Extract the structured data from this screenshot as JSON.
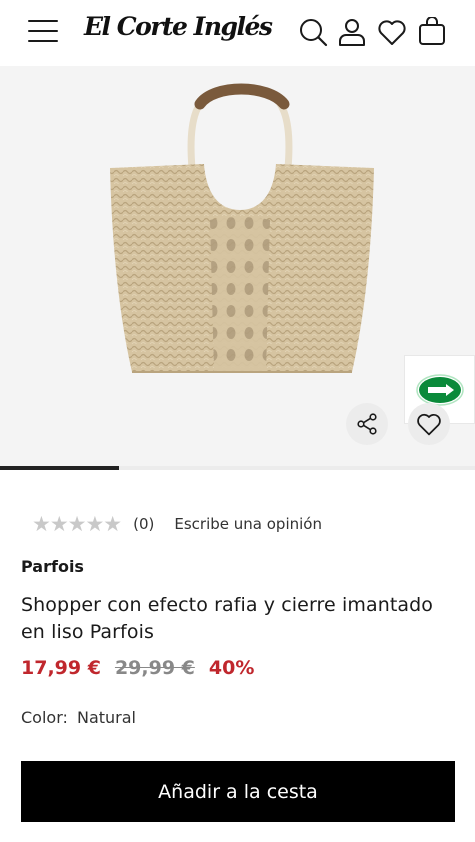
{
  "header": {
    "logo_text": "El Corte Inglés",
    "icons": [
      "menu-icon",
      "search-icon",
      "user-icon",
      "heart-icon",
      "bag-icon"
    ]
  },
  "gallery": {
    "progress_fraction": 0.25,
    "video_button_icon": "play-icon",
    "share_icon": "share-icon",
    "favorite_icon": "heart-icon"
  },
  "product": {
    "rating_stars": "★★★★★",
    "rating_count": "(0)",
    "write_review": "Escribe una opinión",
    "brand": "Parfois",
    "title": "Shopper con efecto rafia y cierre imantado en liso Parfois",
    "price_now": "17,99 €",
    "price_old": "29,99 €",
    "discount": "40%",
    "color_label": "Color:",
    "color_value": "Natural"
  },
  "actions": {
    "add_to_cart": "Añadir a la cesta"
  },
  "colors": {
    "price_red": "#c0272d",
    "play_green": "#0a8a3a",
    "button_black": "#000000",
    "bag_straw": "#d8c6a4"
  }
}
